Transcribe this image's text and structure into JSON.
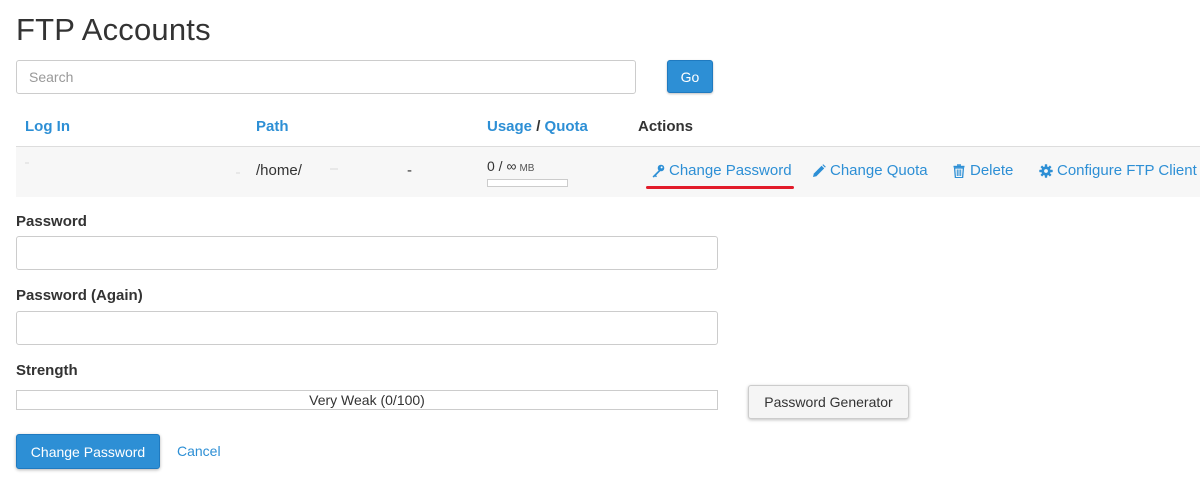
{
  "page": {
    "title": "FTP Accounts"
  },
  "search": {
    "placeholder": "Search",
    "value": "",
    "go_label": "Go"
  },
  "table": {
    "headers": {
      "login": "Log In",
      "path": "Path",
      "usage": "Usage",
      "usage_sep": "/",
      "quota": "Quota",
      "actions": "Actions"
    },
    "row": {
      "path_prefix": "/home/",
      "path_suffix": "-",
      "usage": "0 / ∞",
      "usage_unit": "MB",
      "usage_fraction": 0,
      "actions": {
        "change_password": "Change Password",
        "change_quota": "Change Quota",
        "delete": "Delete",
        "configure": "Configure FTP Client"
      }
    }
  },
  "form": {
    "password_label": "Password",
    "password_again_label": "Password (Again)",
    "strength_label": "Strength",
    "strength_text": "Very Weak (0/100)",
    "strength_value": 0,
    "generator_label": "Password Generator",
    "submit_label": "Change Password",
    "cancel_label": "Cancel"
  },
  "colors": {
    "accent": "#2d8fd5",
    "highlight": "#e21b2a"
  }
}
